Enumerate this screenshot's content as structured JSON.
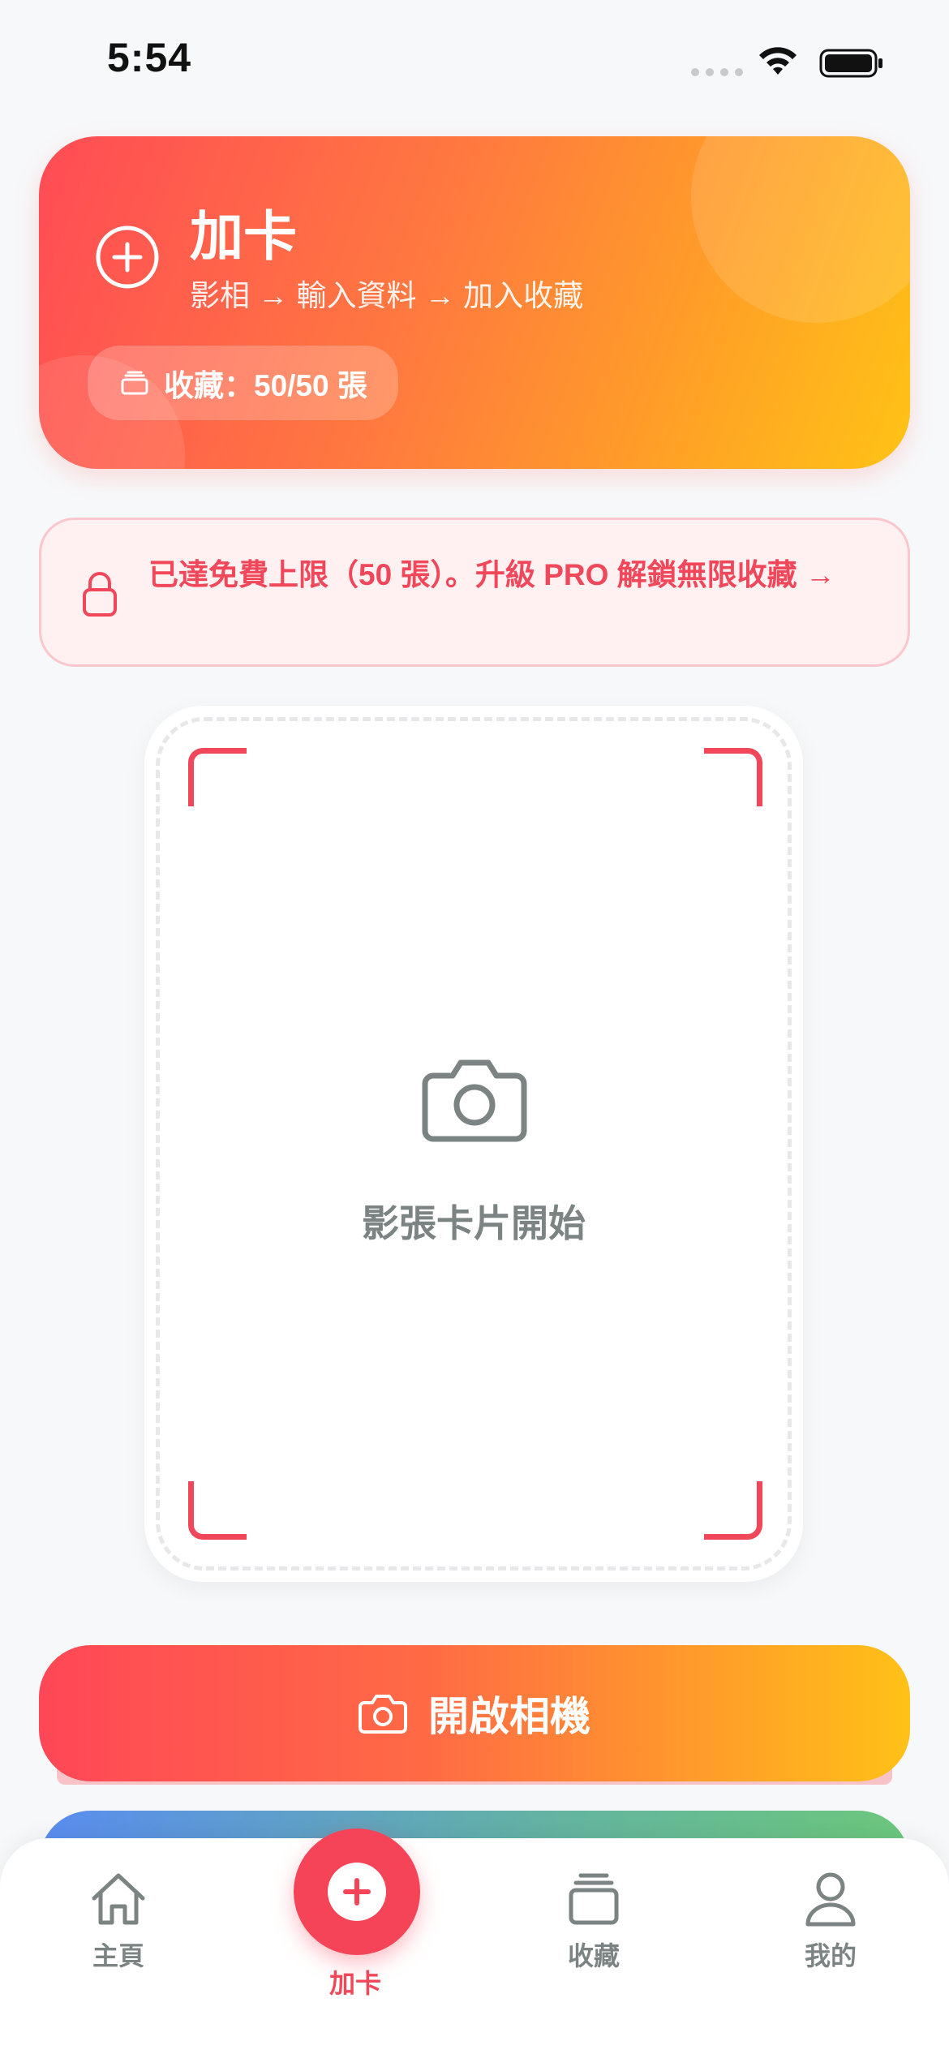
{
  "status_bar": {
    "time": "5:54"
  },
  "hero": {
    "title": "加卡",
    "subtitle": "影相 → 輸入資料 → 加入收藏",
    "collection_count": "收藏：50/50 張",
    "gradient": [
      "#ff4b56",
      "#ffc316"
    ]
  },
  "warning": {
    "text": "已達免費上限（50 張）。升級 PRO 解鎖無限收藏 →",
    "color": "#f0485a"
  },
  "scanner": {
    "prompt": "影張卡片開始"
  },
  "camera_button": {
    "label": "開啟相機"
  },
  "tabs": [
    {
      "label": "主頁",
      "icon": "home-icon"
    },
    {
      "label": "加卡",
      "icon": "plus-icon",
      "active": true
    },
    {
      "label": "收藏",
      "icon": "card-stack-icon"
    },
    {
      "label": "我的",
      "icon": "person-icon"
    }
  ],
  "colors": {
    "accent": "#f0485a",
    "muted": "#7c8483"
  }
}
